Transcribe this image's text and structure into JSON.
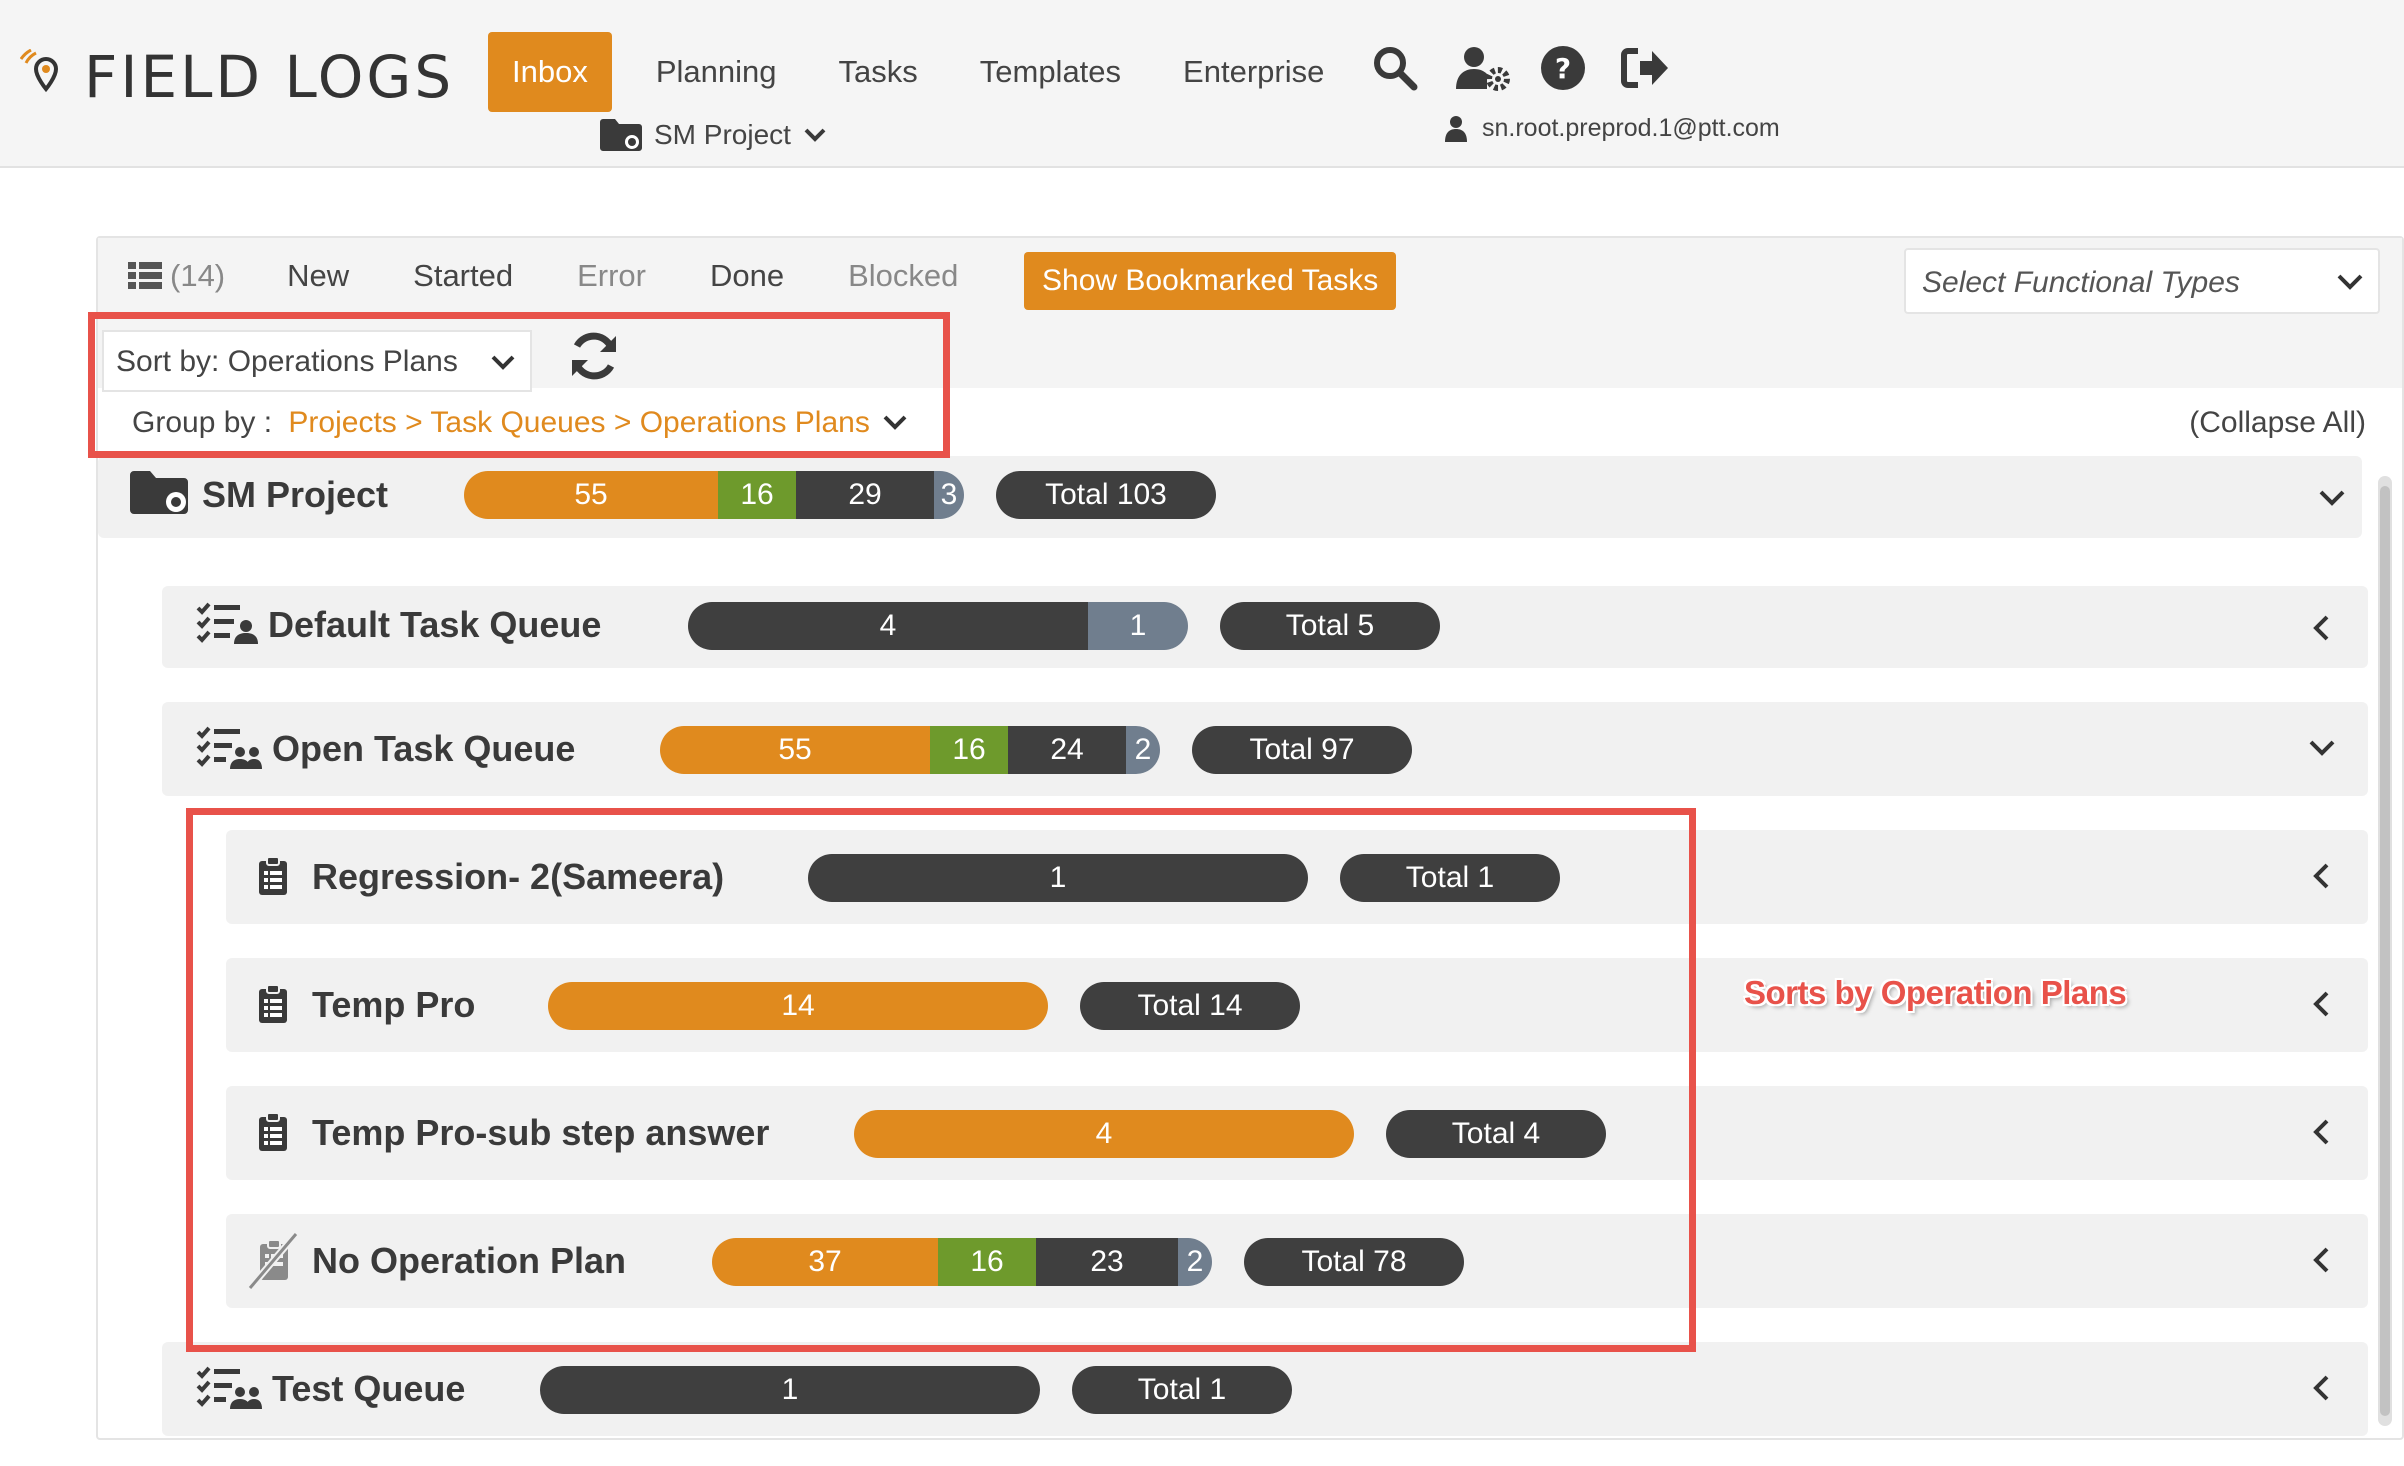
{
  "header": {
    "logo_text": "FIELD LOGS",
    "nav": [
      {
        "label": "Inbox",
        "active": true
      },
      {
        "label": "Planning"
      },
      {
        "label": "Tasks"
      },
      {
        "label": "Templates"
      },
      {
        "label": "Enterprise"
      }
    ],
    "project_selector": "SM Project",
    "user_email": "sn.root.preprod.1@ptt.com",
    "icons": [
      "search-icon",
      "user-settings-icon",
      "help-icon",
      "logout-icon"
    ]
  },
  "toolbar": {
    "task_count": "(14)",
    "filters": [
      "New",
      "Started",
      "Error",
      "Done",
      "Blocked"
    ],
    "bookmark_button": "Show Bookmarked Tasks",
    "functional_types_placeholder": "Select Functional Types",
    "sort_by": "Sort by: Operations Plans",
    "group_by_label": "Group by : ",
    "group_by_path": "Projects > Task Queues > Operations Plans",
    "collapse_all": "(Collapse All)"
  },
  "tree": {
    "project": {
      "name": "SM Project",
      "counts": [
        "55",
        "16",
        "29",
        "3"
      ],
      "total": "Total 103"
    },
    "queues": [
      {
        "name": "Default Task Queue",
        "counts": [
          "4",
          "1"
        ],
        "total": "Total 5"
      },
      {
        "name": "Open Task Queue",
        "counts": [
          "55",
          "16",
          "24",
          "2"
        ],
        "total": "Total 97"
      },
      {
        "name": "Test Queue",
        "counts": [
          "1"
        ],
        "total": "Total 1"
      }
    ],
    "plans": [
      {
        "name": "Regression- 2(Sameera)",
        "counts": [
          "1"
        ],
        "total": "Total 1"
      },
      {
        "name": "Temp Pro",
        "counts": [
          "14"
        ],
        "total": "Total 14"
      },
      {
        "name": "Temp Pro-sub step answer",
        "counts": [
          "4"
        ],
        "total": "Total 4"
      },
      {
        "name": "No Operation Plan",
        "counts": [
          "37",
          "16",
          "23",
          "2"
        ],
        "total": "Total 78"
      }
    ]
  },
  "annotation": {
    "text": "Sorts by Operation Plans",
    "color": "#e8524a"
  },
  "colors": {
    "accent": "#e08a1e",
    "done_green": "#6e9a2c",
    "dark": "#3f3f3f",
    "slate": "#707e8e"
  }
}
